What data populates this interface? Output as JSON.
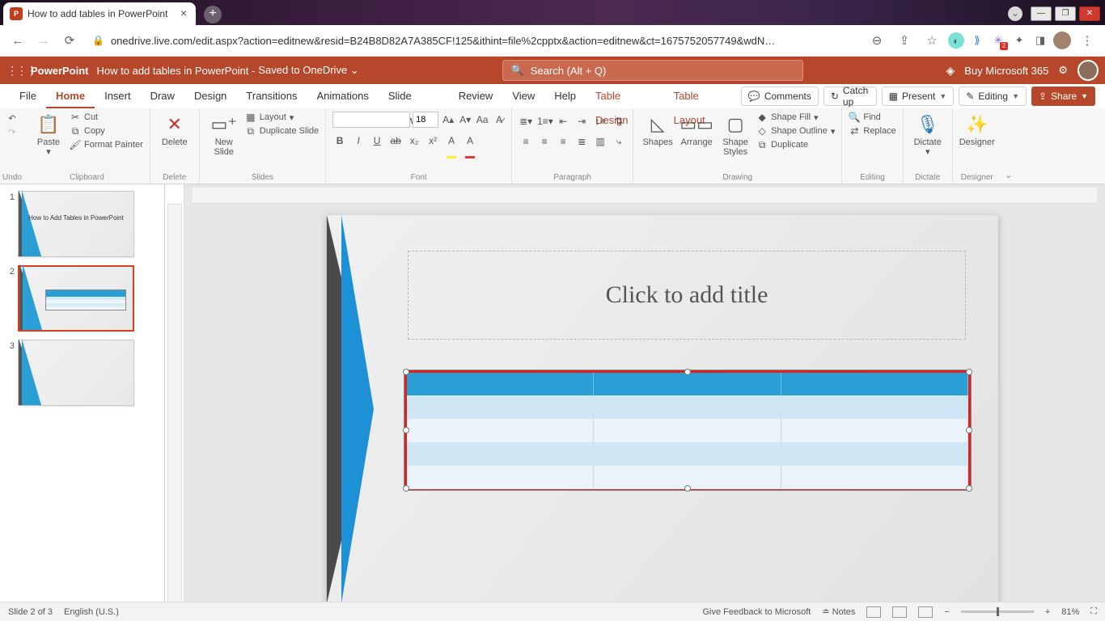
{
  "os": {
    "tab_title": "How to add tables in PowerPoint"
  },
  "chrome": {
    "url": "onedrive.live.com/edit.aspx?action=editnew&resid=B24B8D82A7A385CF!125&ithint=file%2cpptx&action=editnew&ct=1675752057749&wdN…"
  },
  "pp_header": {
    "app": "PowerPoint",
    "doc": "How to add tables in PowerPoint -",
    "saved": "Saved to OneDrive",
    "search_ph": "Search (Alt + Q)",
    "buy": "Buy Microsoft 365"
  },
  "tabs": {
    "file": "File",
    "home": "Home",
    "insert": "Insert",
    "draw": "Draw",
    "design": "Design",
    "transitions": "Transitions",
    "animations": "Animations",
    "slideshow": "Slide Show",
    "review": "Review",
    "view": "View",
    "help": "Help",
    "table_design": "Table Design",
    "table_layout": "Table Layout"
  },
  "rib_right": {
    "comments": "Comments",
    "catchup": "Catch up",
    "present": "Present",
    "editing": "Editing",
    "share": "Share"
  },
  "ribbon": {
    "undo": "Undo",
    "paste": "Paste",
    "cut": "Cut",
    "copy": "Copy",
    "format_painter": "Format Painter",
    "clipboard": "Clipboard",
    "delete": "Delete",
    "delete_grp": "Delete",
    "new_slide": "New\nSlide",
    "layout": "Layout",
    "duplicate_slide": "Duplicate Slide",
    "slides": "Slides",
    "font_size": "18",
    "font": "Font",
    "paragraph": "Paragraph",
    "shapes": "Shapes",
    "arrange": "Arrange",
    "shape_styles": "Shape\nStyles",
    "shape_fill": "Shape Fill",
    "shape_outline": "Shape Outline",
    "duplicate": "Duplicate",
    "drawing": "Drawing",
    "find": "Find",
    "replace": "Replace",
    "editing": "Editing",
    "dictate": "Dictate",
    "dictate_grp": "Dictate",
    "designer": "Designer",
    "designer_grp": "Designer"
  },
  "slide": {
    "title_ph": "Click to add title",
    "thumb1_title": "How to Add Tables in PowerPoint"
  },
  "status": {
    "slide_info": "Slide 2 of 3",
    "lang": "English (U.S.)",
    "feedback": "Give Feedback to Microsoft",
    "notes": "Notes",
    "zoom": "81%"
  }
}
